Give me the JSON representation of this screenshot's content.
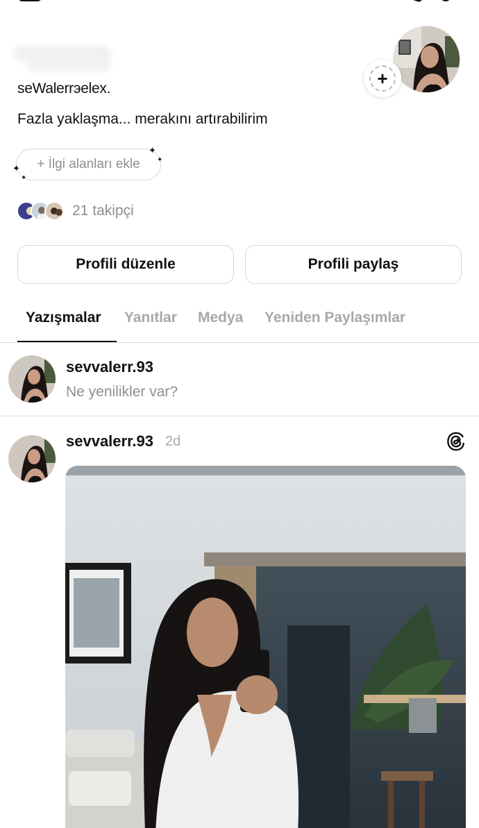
{
  "profile": {
    "display_name": "seWalerrэelex.",
    "bio": "Fazla yaklaşma... merakını artırabilirim",
    "interests_button": "+ İlgi alanları ekle",
    "followers_text": "21 takipçi"
  },
  "actions": {
    "edit_profile": "Profili düzenle",
    "share_profile": "Profili paylaş"
  },
  "tabs": [
    {
      "label": "Yazışmalar",
      "active": true
    },
    {
      "label": "Yanıtlar",
      "active": false
    },
    {
      "label": "Medya",
      "active": false
    },
    {
      "label": "Yeniden Paylaşımlar",
      "active": false
    }
  ],
  "composer": {
    "username": "sevvalerr.93",
    "prompt": "Ne yenilikler var?"
  },
  "post": {
    "username": "sevvalerr.93",
    "time": "2d"
  },
  "icons": {
    "story_add": "plus-icon",
    "app_logo": "threads-logo-icon"
  }
}
